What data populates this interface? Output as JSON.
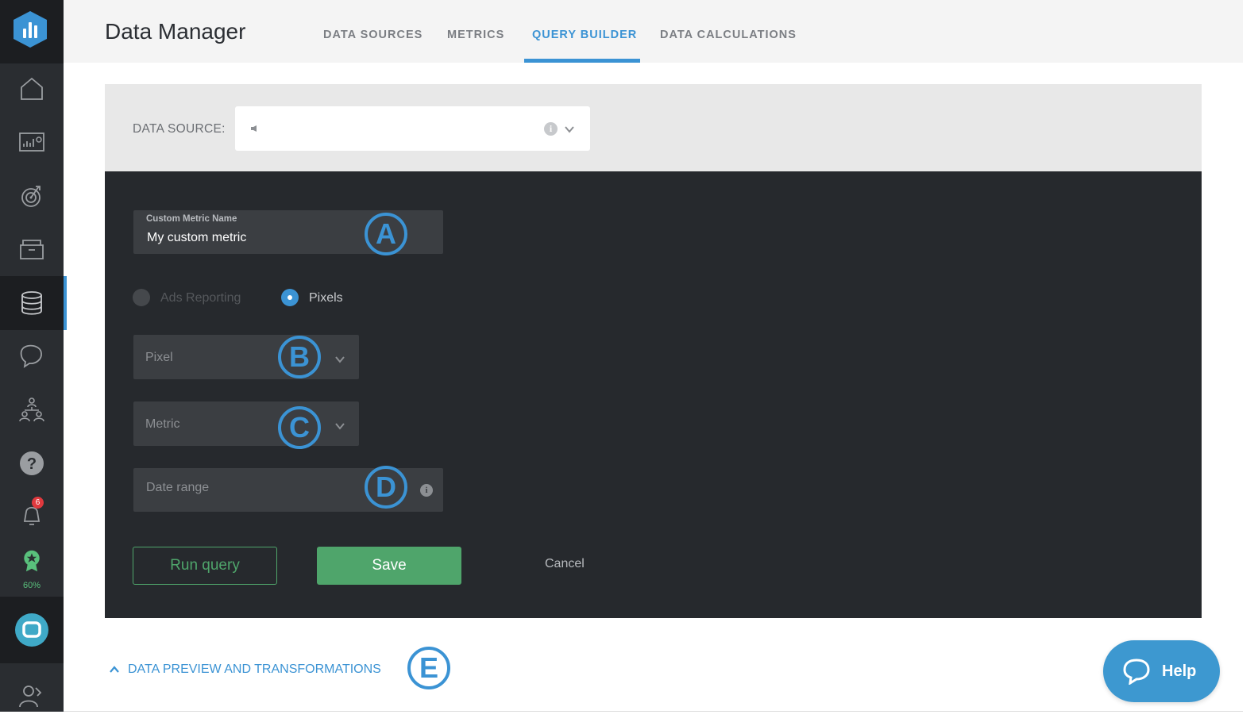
{
  "header": {
    "title": "Data Manager",
    "tabs": [
      {
        "label": "DATA SOURCES",
        "active": false
      },
      {
        "label": "METRICS",
        "active": false
      },
      {
        "label": "QUERY BUILDER",
        "active": true
      },
      {
        "label": "DATA CALCULATIONS",
        "active": false
      }
    ]
  },
  "sidebar": {
    "items": [
      "logo-icon",
      "home-icon",
      "dashboard-icon",
      "goals-icon",
      "archive-icon",
      "database-icon",
      "chat-icon",
      "team-icon",
      "help-icon",
      "alerts-icon",
      "award-icon",
      "user-icon"
    ],
    "notification_count": "6",
    "award_progress": "60%"
  },
  "data_source": {
    "label": "DATA SOURCE:",
    "value": ""
  },
  "form": {
    "metric_name_caption": "Custom Metric Name",
    "metric_name_value": "My custom metric",
    "radio_ads_label": "Ads Reporting",
    "radio_pixels_label": "Pixels",
    "selected_radio": "Pixels",
    "pixel_placeholder": "Pixel",
    "metric_placeholder": "Metric",
    "date_range_placeholder": "Date range",
    "run_query_label": "Run query",
    "save_label": "Save",
    "cancel_label": "Cancel"
  },
  "markers": {
    "a": "A",
    "b": "B",
    "c": "C",
    "d": "D",
    "e": "E"
  },
  "preview": {
    "label": "DATA PREVIEW AND TRANSFORMATIONS"
  },
  "help": {
    "label": "Help"
  },
  "colors": {
    "accent": "#3b93d4",
    "save_green": "#4fa56b",
    "editor_bg": "#26292d",
    "sidebar_bg": "#2a2d31",
    "help_bg": "#3d98d0"
  }
}
